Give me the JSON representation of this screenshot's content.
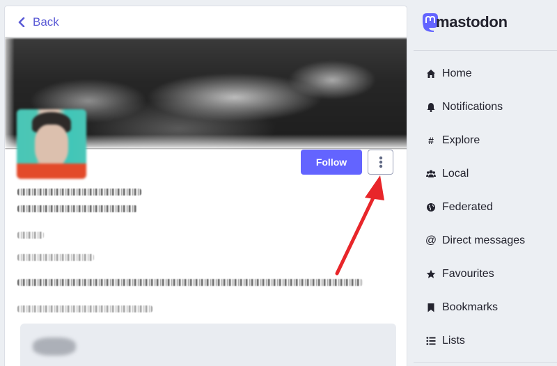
{
  "back": {
    "label": "Back"
  },
  "profile": {
    "follow_label": "Follow"
  },
  "brand": {
    "name": "mastodon"
  },
  "nav": {
    "items": [
      {
        "label": "Home",
        "icon": "home-icon"
      },
      {
        "label": "Notifications",
        "icon": "bell-icon"
      },
      {
        "label": "Explore",
        "icon": "hashtag-icon"
      },
      {
        "label": "Local",
        "icon": "users-icon"
      },
      {
        "label": "Federated",
        "icon": "globe-icon"
      },
      {
        "label": "Direct messages",
        "icon": "at-icon"
      },
      {
        "label": "Favourites",
        "icon": "star-icon"
      },
      {
        "label": "Bookmarks",
        "icon": "bookmark-icon"
      },
      {
        "label": "Lists",
        "icon": "list-icon"
      }
    ]
  },
  "colors": {
    "accent": "#6364ff",
    "link": "#5b5bd6",
    "annotation_arrow": "#e8262a"
  }
}
